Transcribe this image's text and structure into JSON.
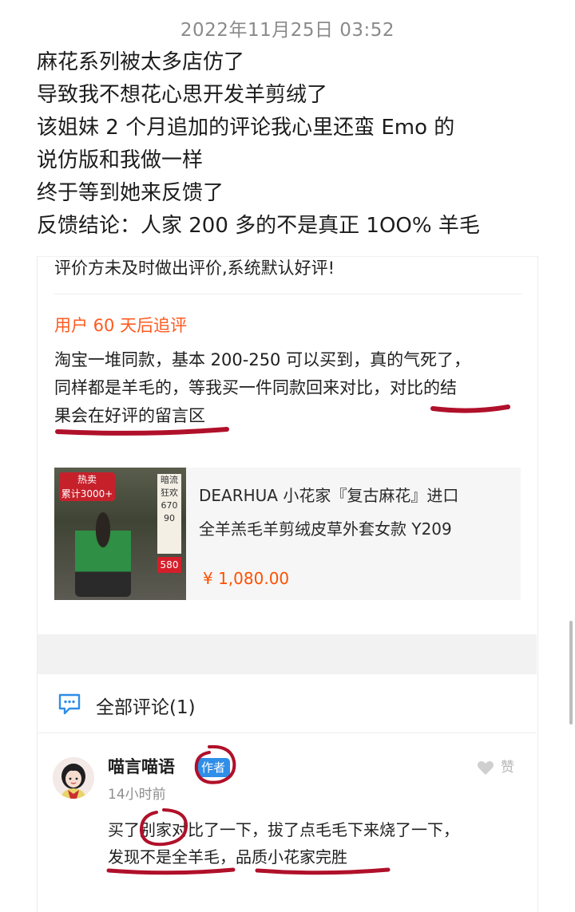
{
  "timestamp": "2022年11月25日 03:52",
  "post": {
    "lines": [
      "麻花系列被太多店仿了",
      "导致我不想花心思开发羊剪绒了",
      "该姐妹 2 个月追加的评论我心里还蛮 Emo 的",
      "说仿版和我做一样",
      "终于等到她来反馈了",
      "反馈结论：人家 200 多的不是真正 1OO% 羊毛"
    ]
  },
  "review_card": {
    "previous_text": "评价方未及时做出评价,系统默认好评!",
    "followup_label": "用户 60 天后追评",
    "followup_lines": [
      "淘宝一堆同款，基本 200-250 可以买到，真的气死了，",
      "同样都是羊毛的，等我买一件同款回来对比，对比的结",
      "果会在好评的留言区"
    ],
    "product": {
      "title_lines": [
        "DEARHUA 小花家『复古麻花』进口",
        "全羊羔毛羊剪绒皮草外套女款 Y209"
      ],
      "price": "¥ 1,080.00",
      "image_texts": {
        "tag_main": "热卖",
        "tag_sub": "累计3000+",
        "side_title": "暗流狂欢",
        "side_a": "670",
        "side_b": "90",
        "side_price": "580"
      }
    }
  },
  "comments": {
    "header": "全部评论(1)",
    "items": [
      {
        "author": "喵言喵语",
        "badge": "作者",
        "time": "14小时前",
        "like_label": "赞",
        "lines": [
          "买了别家对比了一下，拔了点毛毛下来烧了一下，",
          "发现不是全羊毛，品质小花家完胜"
        ]
      }
    ]
  },
  "icons": {
    "comment": "comment-bubble-icon",
    "like": "heart-icon"
  },
  "colors": {
    "accent_orange": "#ff5a1f",
    "badge_blue": "#2f8ee8",
    "annotation_red": "#b0102a"
  }
}
